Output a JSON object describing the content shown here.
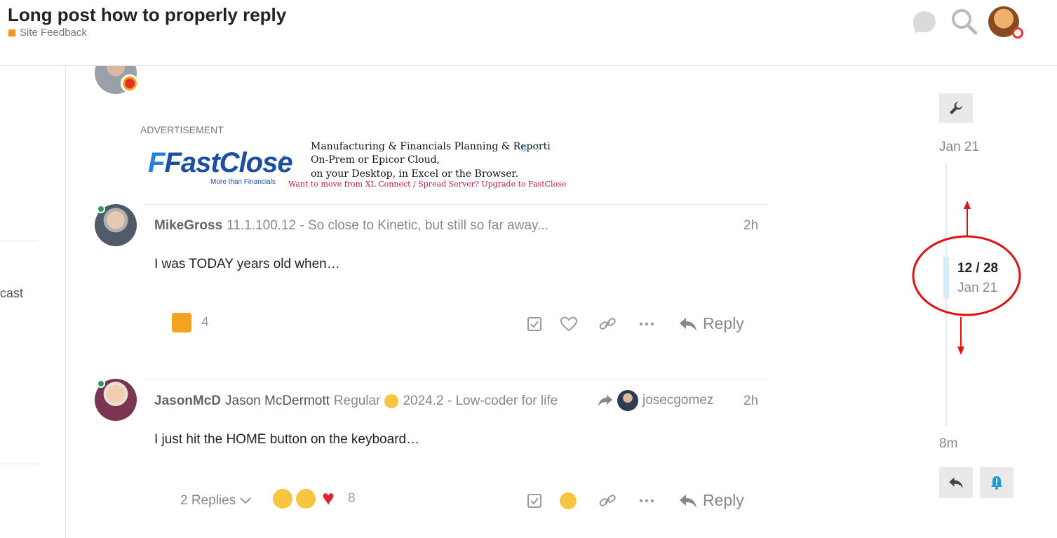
{
  "header": {
    "title": "Long post how to properly reply",
    "category": "Site Feedback",
    "category_color": "#f7941d"
  },
  "left_rail": {
    "partial_text": "cast"
  },
  "ad": {
    "label": "ADVERTISEMENT",
    "brand": "FastClose",
    "brand_reg": "®",
    "brand_sub": "More than Financials",
    "line1": "Manufacturing & Financials Planning & Reporti",
    "line2": "On-Prem or Epicor Cloud,",
    "line3": "on your Desktop, in Excel or the Browser.",
    "cta": "Want to move from XL Connect / Spread Server? Upgrade to FastClose"
  },
  "posts": [
    {
      "username": "MikeGross",
      "title": "11.1.100.12 - So close to Kinetic, but still so far away...",
      "time": "2h",
      "body": "I was TODAY years old when…",
      "reaction_count": "4",
      "reply_label": "Reply"
    },
    {
      "username": "JasonMcD",
      "full_name": "Jason McDermott",
      "user_title": "Regular",
      "flair_text": "2024.2 - Low-coder for life",
      "reply_to": "josecgomez",
      "time": "2h",
      "body": "I just hit the HOME button on the keyboard…",
      "replies_label": "2 Replies",
      "reaction_count": "8",
      "reply_label": "Reply"
    }
  ],
  "timeline": {
    "top_date": "Jan 21",
    "position": "12 / 28",
    "position_date": "Jan 21",
    "bottom_date": "8m"
  },
  "annotation_color": "#e01010",
  "accent_color": "#1a9ad9"
}
